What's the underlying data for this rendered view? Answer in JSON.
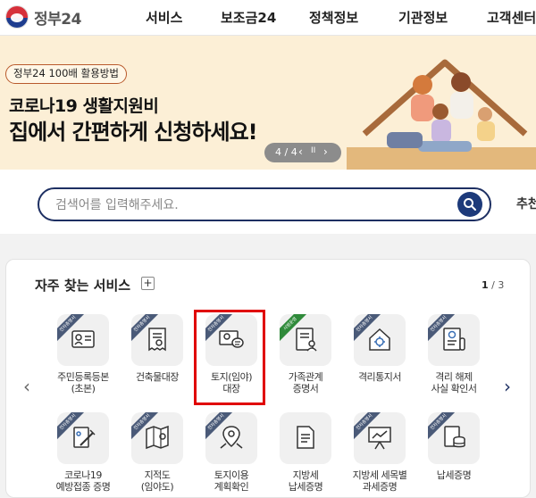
{
  "header": {
    "logo_text": "정부24",
    "nav": [
      "서비스",
      "보조금24",
      "정책정보",
      "기관정보",
      "고객센터"
    ]
  },
  "banner": {
    "tag": "정부24 100배 활용방법",
    "title_line1": "코로나19 생활지원비",
    "title_line2": "집에서 간편하게 신청하세요!",
    "pager": {
      "current": "4 / 4",
      "prev": "‹",
      "pause": "II",
      "next": "›"
    }
  },
  "search": {
    "placeholder": "검색어를 입력해주세요.",
    "side_link": "추천"
  },
  "services": {
    "title": "자주 찾는 서비스",
    "plus": "+",
    "page_current": "1",
    "page_total": "/ 3",
    "ribbon_label": "전자증명서",
    "ribbon_green_label": "시범운영",
    "items": [
      {
        "label": "주민등록등본\n(초본)",
        "icon": "id-card-icon",
        "ribbon": "전자증명서"
      },
      {
        "label": "건축물대장",
        "icon": "receipt-icon",
        "ribbon": "전자증명서"
      },
      {
        "label": "토지(임야)\n대장",
        "icon": "land-map-icon",
        "ribbon": "전자증명서"
      },
      {
        "label": "가족관계\n증명서",
        "icon": "family-document-icon",
        "ribbon": "시범운영"
      },
      {
        "label": "격리통지서",
        "icon": "house-virus-icon",
        "ribbon": "전자증명서"
      },
      {
        "label": "격리 해제\n사실 확인서",
        "icon": "release-document-icon",
        "ribbon": "전자증명서"
      },
      {
        "label": "코로나19\n예방접종 증명",
        "icon": "vaccine-icon",
        "ribbon": "전자증명서"
      },
      {
        "label": "지적도\n(임야도)",
        "icon": "map-icon",
        "ribbon": "전자증명서"
      },
      {
        "label": "토지이용\n계획확인",
        "icon": "location-pin-icon",
        "ribbon": "전자증명서"
      },
      {
        "label": "지방세\n납세증명",
        "icon": "tax-document-icon",
        "ribbon": ""
      },
      {
        "label": "지방세 세목별\n과세증명",
        "icon": "presentation-chart-icon",
        "ribbon": "전자증명서"
      },
      {
        "label": "납세증명",
        "icon": "coins-icon",
        "ribbon": "전자증명서"
      }
    ]
  },
  "colors": {
    "brand_navy": "#1d2f62",
    "banner_bg": "#fcefd6",
    "highlight": "#e00000"
  }
}
